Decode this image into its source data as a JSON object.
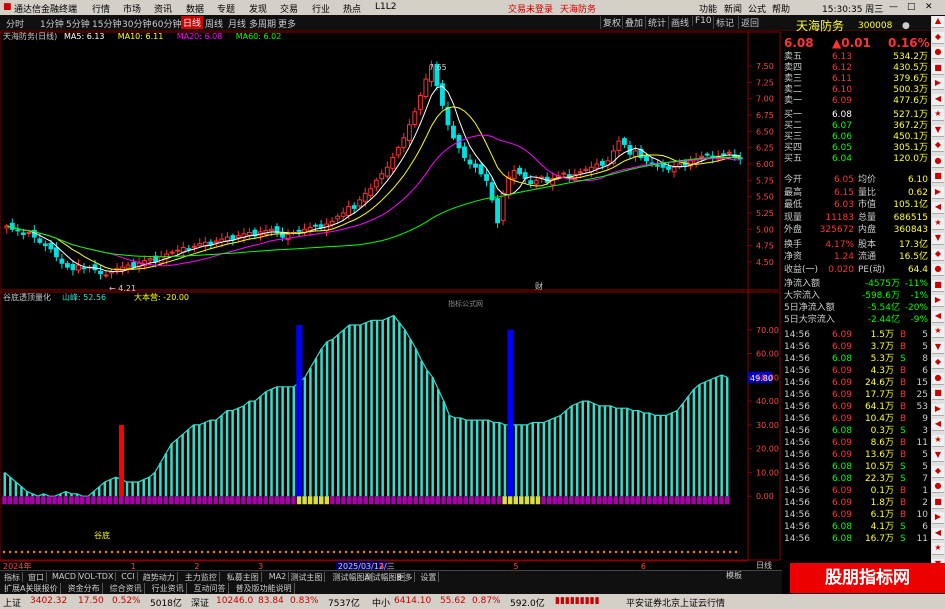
{
  "app": {
    "title": "通达信金融终端",
    "menus": [
      "行情",
      "市场",
      "资讯",
      "数据",
      "专题",
      "发现",
      "交易",
      "行业",
      "热点",
      "L1L2"
    ],
    "notices": [
      "交易未登录",
      "天海防务"
    ],
    "right_menus": [
      "功能",
      "新闻",
      "公式",
      "帮助"
    ],
    "clock": "15:30:35 周三"
  },
  "toolbar": {
    "periods": [
      "分时",
      "1分钟",
      "5分钟",
      "15分钟",
      "30分钟",
      "60分钟",
      "日线",
      "周线",
      "月线",
      "多周期",
      "更多"
    ],
    "active_period": "日线",
    "right_buttons": [
      "复权",
      "叠加",
      "统计",
      "画线",
      "F10",
      "标记",
      "返回"
    ]
  },
  "stock": {
    "name": "天海防务",
    "code": "300008",
    "price": "6.08",
    "change": "▲0.01",
    "pct": "0.16%"
  },
  "order_book": [
    {
      "label": "卖五",
      "price": "6.13",
      "vol": "534.2万"
    },
    {
      "label": "卖四",
      "price": "6.12",
      "vol": "430.5万"
    },
    {
      "label": "卖三",
      "price": "6.11",
      "vol": "379.6万"
    },
    {
      "label": "卖二",
      "price": "6.10",
      "vol": "500.3万"
    },
    {
      "label": "卖一",
      "price": "6.09",
      "vol": "477.6万"
    },
    {
      "label": "买一",
      "price": "6.08",
      "vol": "527.1万"
    },
    {
      "label": "买二",
      "price": "6.07",
      "vol": "367.2万"
    },
    {
      "label": "买三",
      "price": "6.06",
      "vol": "450.1万"
    },
    {
      "label": "买四",
      "price": "6.05",
      "vol": "305.1万"
    },
    {
      "label": "买五",
      "price": "6.04",
      "vol": "120.0万"
    }
  ],
  "stats": [
    {
      "k1": "今开",
      "v1": "6.05",
      "k2": "均价",
      "v2": "6.10"
    },
    {
      "k1": "最高",
      "v1": "6.15",
      "k2": "量比",
      "v2": "0.62"
    },
    {
      "k1": "最低",
      "v1": "6.03",
      "k2": "市值",
      "v2": "105.1亿"
    },
    {
      "k1": "现量",
      "v1": "11183",
      "k2": "总量",
      "v2": "686515"
    },
    {
      "k1": "外盘",
      "v1": "325672",
      "k2": "内盘",
      "v2": "360843"
    },
    {
      "k1": "换手",
      "v1": "4.17%",
      "k2": "股本",
      "v2": "17.3亿"
    },
    {
      "k1": "净资",
      "v1": "1.24",
      "k2": "流通",
      "v2": "16.5亿"
    },
    {
      "k1": "收益(一)",
      "v1": "0.020",
      "k2": "PE(动)",
      "v2": "64.4"
    }
  ],
  "flows": [
    {
      "label": "净流入额",
      "v1": "-4575万",
      "v2": "-11%"
    },
    {
      "label": "大宗流入",
      "v1": "-598.6万",
      "v2": "-1%"
    },
    {
      "label": "5日净流入额",
      "v1": "-5.54亿",
      "v2": "-20%"
    },
    {
      "label": "5日大宗流入",
      "v1": "-2.44亿",
      "v2": "-9%"
    }
  ],
  "ticks": [
    {
      "t": "14:56",
      "p": "6.09",
      "v": "1.5万",
      "bs": "B",
      "n": "5"
    },
    {
      "t": "14:56",
      "p": "6.09",
      "v": "3.7万",
      "bs": "B",
      "n": "5"
    },
    {
      "t": "14:56",
      "p": "6.08",
      "v": "5.3万",
      "bs": "S",
      "n": "8"
    },
    {
      "t": "14:56",
      "p": "6.09",
      "v": "4.3万",
      "bs": "B",
      "n": "6"
    },
    {
      "t": "14:56",
      "p": "6.09",
      "v": "24.6万",
      "bs": "B",
      "n": "15"
    },
    {
      "t": "14:56",
      "p": "6.09",
      "v": "17.7万",
      "bs": "B",
      "n": "25"
    },
    {
      "t": "14:56",
      "p": "6.09",
      "v": "64.1万",
      "bs": "B",
      "n": "53"
    },
    {
      "t": "14:56",
      "p": "6.09",
      "v": "10.4万",
      "bs": "B",
      "n": "9"
    },
    {
      "t": "14:56",
      "p": "6.08",
      "v": "0.3万",
      "bs": "S",
      "n": "3"
    },
    {
      "t": "14:56",
      "p": "6.09",
      "v": "8.6万",
      "bs": "B",
      "n": "11"
    },
    {
      "t": "14:56",
      "p": "6.09",
      "v": "13.6万",
      "bs": "B",
      "n": "5"
    },
    {
      "t": "14:56",
      "p": "6.08",
      "v": "10.5万",
      "bs": "S",
      "n": "5"
    },
    {
      "t": "14:56",
      "p": "6.08",
      "v": "22.3万",
      "bs": "S",
      "n": "7"
    },
    {
      "t": "14:56",
      "p": "6.09",
      "v": "0.1万",
      "bs": "B",
      "n": "1"
    },
    {
      "t": "14:56",
      "p": "6.09",
      "v": "1.8万",
      "bs": "B",
      "n": "2"
    },
    {
      "t": "14:56",
      "p": "6.09",
      "v": "6.1万",
      "bs": "B",
      "n": "10"
    },
    {
      "t": "14:56",
      "p": "6.08",
      "v": "4.1万",
      "bs": "S",
      "n": "6"
    },
    {
      "t": "14:56",
      "p": "6.08",
      "v": "16.7万",
      "bs": "S",
      "n": "11"
    }
  ],
  "bottom_tabs": [
    "指标",
    "窗口",
    "MACD",
    "VOL-TDX",
    "CCI",
    "趋势动力",
    "主力监控",
    "私募主图",
    "MA2",
    "测试主图",
    "测试幅图A",
    "测试幅图B",
    "更多",
    "设置"
  ],
  "bottom_tabs2": [
    "扩展A",
    "关联报价",
    "资金分布",
    "综合资讯",
    "行业资讯",
    "互动问答",
    "普及版功能说明"
  ],
  "right_bottom": [
    "模板",
    "日线"
  ],
  "status": {
    "idx1_name": "上证",
    "idx1": "3402.32",
    "idx1_ch": "17.50",
    "idx1_pct": "0.52%",
    "idx1_amt": "5018亿",
    "idx2_name": "深证",
    "idx2": "10246.0",
    "idx2_ch": "83.84",
    "idx2_pct": "0.83%",
    "idx2_amt": "7537亿",
    "idx3_name": "中小",
    "idx3": "6414.10",
    "idx3_ch": "55.62",
    "idx3_pct": "0.87%",
    "idx3_amt": "592.0亿",
    "broker": "平安证券北京上证云行情"
  },
  "watermark": "股朋指标网\nwww.7gpzb.com",
  "colors": {
    "up": "#ff3232",
    "down": "#00e0e0",
    "ma5": "#ffffff",
    "ma10": "#ffff00",
    "ma20": "#ff00ff",
    "ma60": "#00ff00",
    "osc": "#33ddcc"
  },
  "chart_data": [
    {
      "type": "candlestick",
      "title": "天海防务(日线)",
      "legend": [
        {
          "name": "MA5",
          "value": "6.13",
          "color": "#ffffff"
        },
        {
          "name": "MA10",
          "value": "6.11",
          "color": "#ffff00"
        },
        {
          "name": "MA20",
          "value": "6.08",
          "color": "#ff00ff"
        },
        {
          "name": "MA60",
          "value": "6.02",
          "color": "#00ff00"
        }
      ],
      "ylim": [
        4.1,
        7.9
      ],
      "yticks": [
        4.5,
        4.75,
        5.0,
        5.25,
        5.5,
        5.75,
        6.0,
        6.25,
        6.5,
        6.75,
        7.0,
        7.25,
        7.5
      ],
      "annotations": [
        {
          "label": "7.65",
          "idx": 76
        },
        {
          "label": "4.21",
          "idx": 18
        }
      ],
      "marker": "财",
      "close": [
        5.05,
        5.0,
        4.98,
        4.92,
        4.95,
        4.88,
        4.8,
        4.75,
        4.7,
        4.58,
        4.48,
        4.42,
        4.38,
        4.45,
        4.4,
        4.42,
        4.38,
        4.32,
        4.3,
        4.35,
        4.4,
        4.42,
        4.45,
        4.42,
        4.48,
        4.52,
        4.55,
        4.5,
        4.58,
        4.62,
        4.65,
        4.68,
        4.72,
        4.7,
        4.74,
        4.78,
        4.8,
        4.76,
        4.82,
        4.85,
        4.88,
        4.84,
        4.9,
        4.93,
        4.95,
        4.9,
        4.96,
        4.98,
        5.0,
        4.95,
        4.88,
        4.92,
        4.95,
        4.98,
        5.0,
        5.03,
        5.05,
        5.02,
        5.08,
        5.12,
        5.2,
        5.25,
        5.35,
        5.32,
        5.45,
        5.55,
        5.62,
        5.75,
        5.85,
        5.95,
        6.1,
        6.25,
        6.4,
        6.6,
        6.8,
        7.05,
        7.3,
        7.5,
        7.2,
        6.9,
        6.6,
        6.4,
        6.25,
        6.1,
        6.0,
        5.95,
        5.85,
        5.75,
        5.45,
        5.1,
        5.55,
        5.8,
        5.9,
        5.85,
        5.78,
        5.7,
        5.75,
        5.8,
        5.72,
        5.78,
        5.82,
        5.86,
        5.8,
        5.84,
        5.88,
        5.92,
        5.95,
        6.0,
        5.98,
        6.05,
        6.2,
        6.35,
        6.3,
        6.15,
        6.2,
        6.1,
        6.05,
        6.0,
        5.98,
        5.95,
        5.92,
        5.95,
        6.0,
        5.98,
        6.05,
        6.08,
        6.12,
        6.15,
        6.1,
        6.12,
        6.15,
        6.18,
        6.1,
        6.08
      ],
      "ma5_last": 6.13,
      "ma10_last": 6.11,
      "ma20_last": 6.08,
      "ma60_last": 6.02
    },
    {
      "type": "bar",
      "title": "谷底透顶量化",
      "legend": [
        {
          "name": "山峰",
          "value": "52.56",
          "color": "#33ddcc"
        },
        {
          "name": "大本营",
          "value": "-20.00",
          "color": "#ffff00"
        }
      ],
      "ylim": [
        -10,
        80
      ],
      "yticks": [
        0.0,
        10.0,
        20.0,
        30.0,
        40.0,
        50.0,
        60.0,
        70.0
      ],
      "current_marker": "49.80",
      "center_label": "指标公式网",
      "bottom_label": "谷底",
      "values": [
        10,
        8,
        6,
        4,
        2,
        1,
        0,
        1,
        0,
        0,
        1,
        2,
        1,
        1,
        0,
        0,
        2,
        4,
        6,
        7,
        8,
        7,
        6,
        6,
        6,
        7,
        8,
        10,
        14,
        18,
        22,
        24,
        26,
        28,
        30,
        30,
        31,
        32,
        32,
        34,
        36,
        36,
        37,
        38,
        40,
        40,
        42,
        44,
        45,
        46,
        46,
        46,
        46,
        48,
        50,
        54,
        58,
        62,
        65,
        66,
        68,
        70,
        72,
        72,
        72,
        73,
        74,
        74,
        74,
        75,
        76,
        73,
        70,
        66,
        62,
        57,
        53,
        50,
        45,
        40,
        34,
        33,
        33,
        32,
        32,
        32,
        32,
        32,
        31,
        31,
        30,
        30,
        30,
        30,
        30,
        31,
        31,
        31,
        32,
        33,
        34,
        36,
        38,
        39,
        40,
        40,
        39,
        38,
        38,
        38,
        37,
        37,
        37,
        36,
        36,
        35,
        35,
        34,
        34,
        34,
        35,
        36,
        39,
        42,
        45,
        47,
        48,
        49,
        50,
        51,
        50
      ],
      "red_bars": [
        {
          "idx": 21,
          "value": 30
        }
      ],
      "blue_bars": [
        {
          "idx": 53,
          "value": 72
        },
        {
          "idx": 91,
          "value": 70
        }
      ]
    }
  ],
  "xaxis_labels": [
    {
      "label": "2024年",
      "idx": 0
    },
    {
      "label": "1",
      "idx": 40
    },
    {
      "label": "2",
      "idx": 60
    },
    {
      "label": "3",
      "idx": 80
    },
    {
      "label": "2025/03/12/三",
      "idx": 105
    },
    {
      "label": "4",
      "idx": 118
    },
    {
      "label": "5",
      "idx": 160
    },
    {
      "label": "6",
      "idx": 200
    }
  ]
}
